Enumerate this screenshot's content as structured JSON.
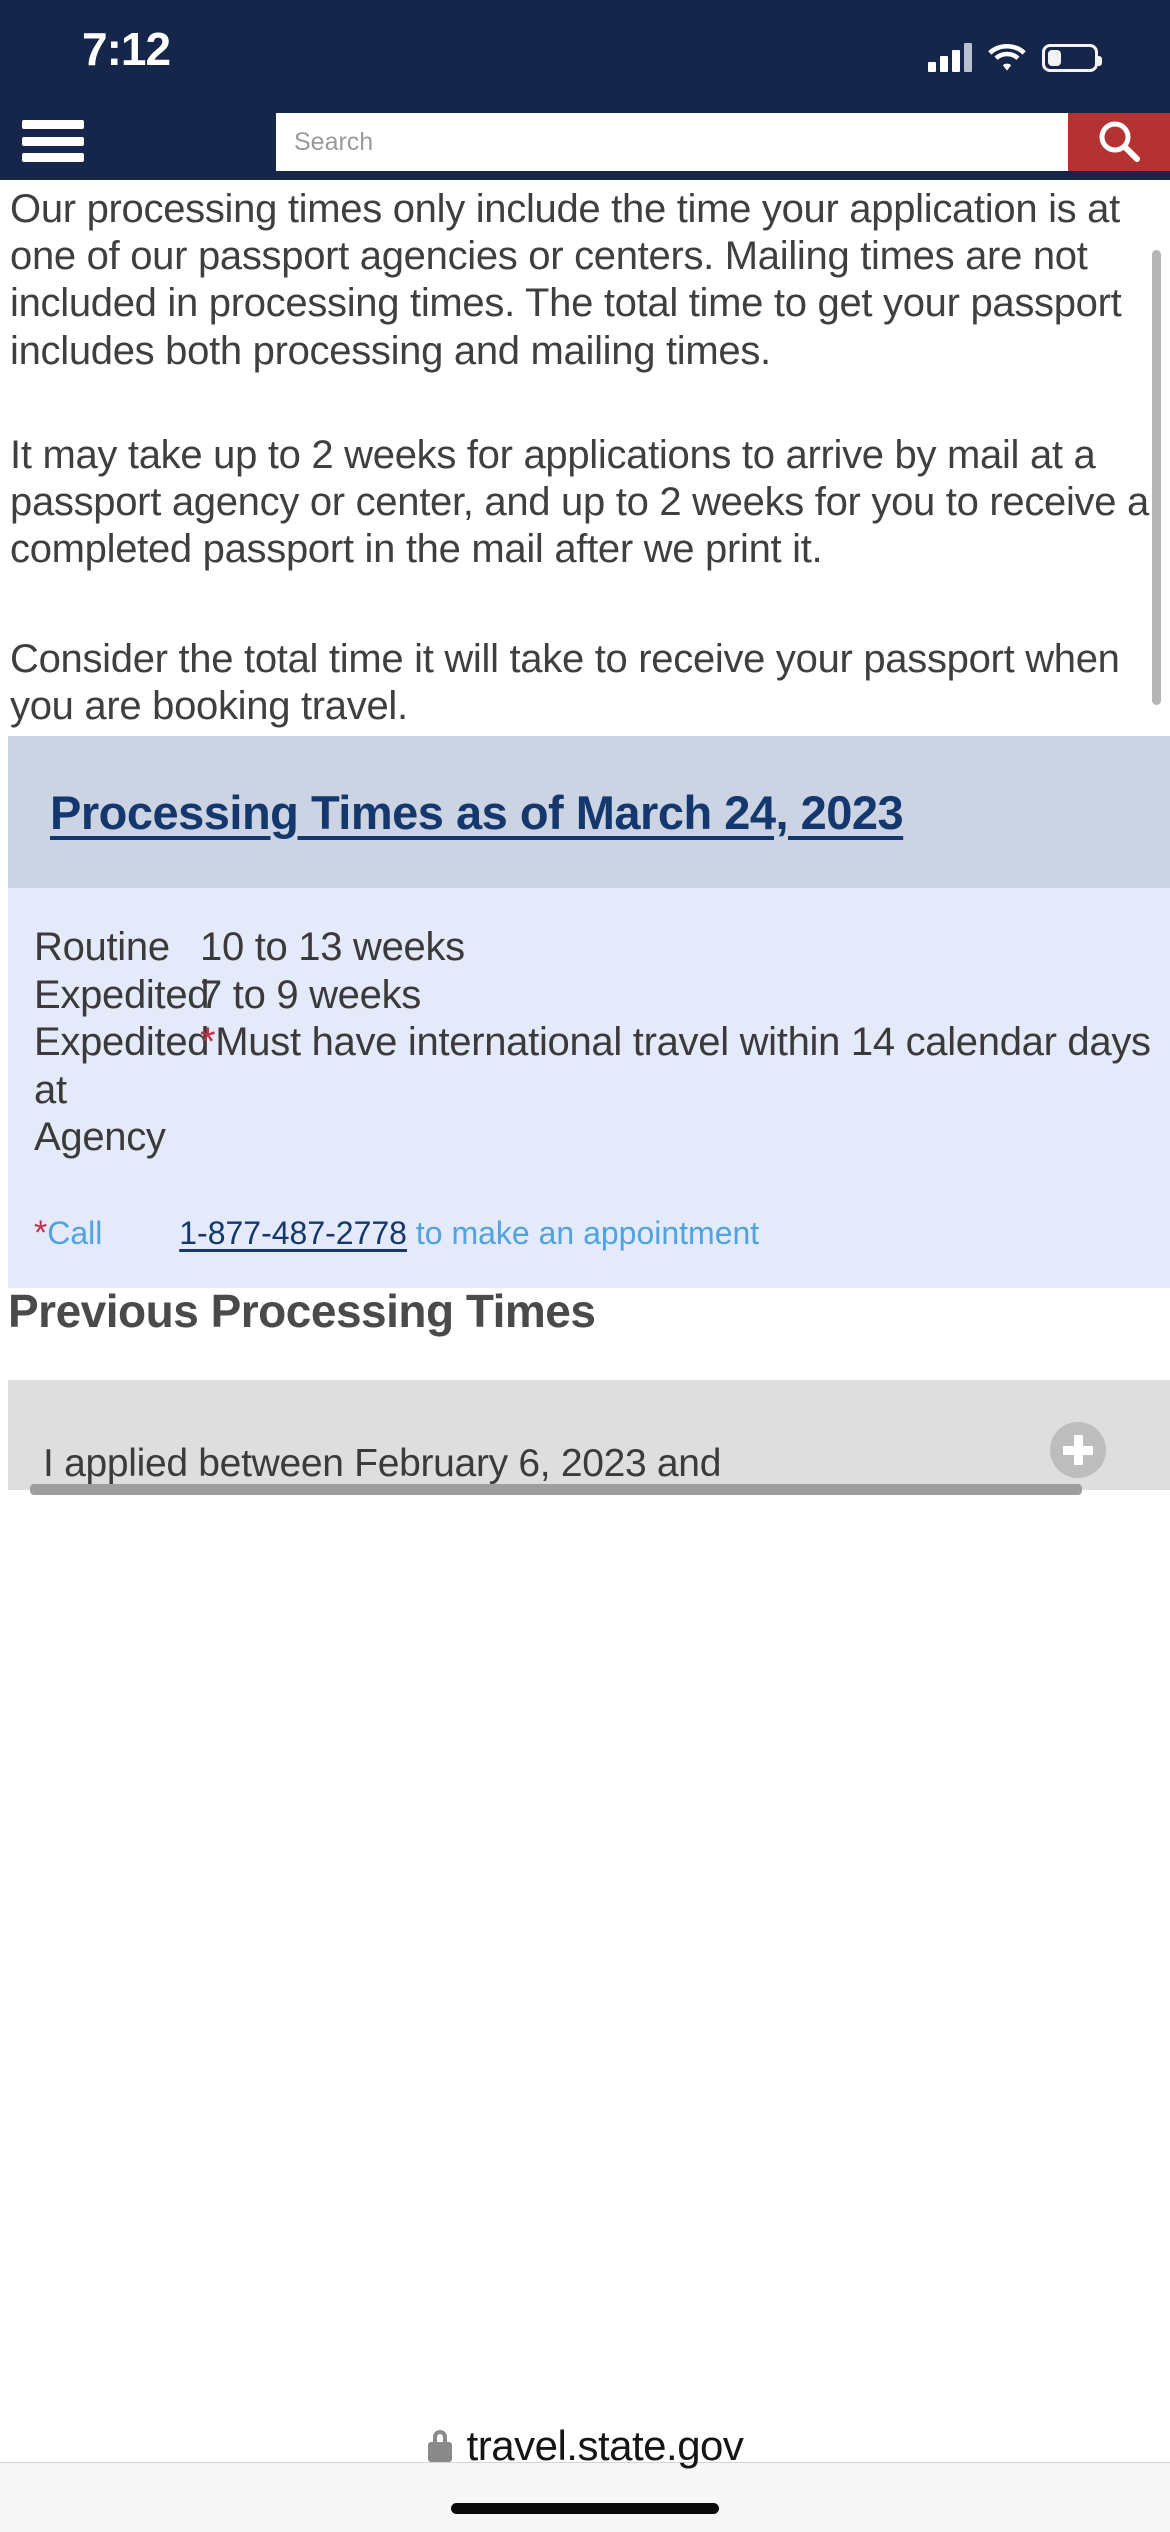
{
  "status_bar": {
    "time": "7:12",
    "signal_icon": "cellular-signal-icon",
    "wifi_icon": "wifi-icon",
    "battery_icon": "battery-icon"
  },
  "site_nav": {
    "menu_icon": "hamburger-menu-icon",
    "search_placeholder": "Search",
    "search_value": "",
    "search_icon": "search-magnifier-icon",
    "search_button_color": "#b53232",
    "nav_background": "#15264a"
  },
  "content": {
    "paragraph_1": "Our processing times only include the time your application is at one of our passport agencies or centers. Mailing times are not included in processing times. The total time to get your passport includes both processing and mailing times.",
    "paragraph_2": "It may take up to 2 weeks for applications to arrive by mail at a passport agency or center, and up to 2 weeks for you to receive a completed passport in the mail after we print it.",
    "paragraph_3": "Consider the total time it will take to receive your passport when you are booking travel."
  },
  "processing_times": {
    "heading": "Processing Times as of March 24, 2023",
    "heading_color": "#14386e",
    "header_background": "#ccd3e2",
    "body_background": "#e4eaf9",
    "rows": [
      {
        "label": "Routine",
        "value": "10 to 13 weeks",
        "has_asterisk": false
      },
      {
        "label": "Expedited",
        "value": "7 to 9 weeks",
        "has_asterisk": false
      },
      {
        "label": "Expedited at Agency",
        "value": "Must have international travel within 14 calendar days",
        "has_asterisk": true
      }
    ],
    "footnote": {
      "asterisk": "*",
      "asterisk_color": "#c0304a",
      "call_label": "Call",
      "phone": "1-877-487-2778",
      "suffix": "to make an appointment",
      "text_color": "#4ea3e0",
      "link_color": "#14386e"
    }
  },
  "previous_section": {
    "title": "Previous Processing Times",
    "accordion_items": [
      {
        "label": "I applied between February 6, 2023 and",
        "expand_icon": "plus-circle-icon"
      }
    ]
  },
  "browser": {
    "lock_icon": "lock-icon",
    "url": "travel.state.gov"
  }
}
